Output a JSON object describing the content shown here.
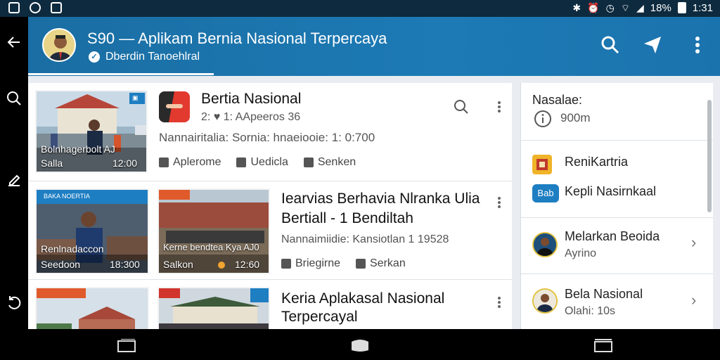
{
  "status_bar": {
    "battery": "18%",
    "time": "1:31"
  },
  "app_bar": {
    "title": "S90 — Aplikam Bernia Nasional Terpercaya",
    "subtitle": "Dberdin Tanoehlral"
  },
  "feed": {
    "cards": [
      {
        "thumb_caption": "Bolnhagerbolt AJ",
        "thumb_caption2": "Salla",
        "thumb_time": "12:00",
        "title": "Bertia Nasional",
        "byline": "2: ♥ 1: AApeeros 36",
        "meta": "Nannairitalia: Sornia: hnaeiooie: 1: 0:700",
        "actions": [
          "Aplerome",
          "Uedicla",
          "Senken"
        ]
      },
      {
        "thumb_badge": "BAKA NOERTIA",
        "thumb_caption": "Renlnadaccon",
        "thumb_caption2": "Seedoon",
        "thumb_time": "18:300",
        "thumb2_caption": "Kerne bendtea Kya AJ0",
        "thumb2_caption2": "Salkon",
        "thumb2_time": "12:60",
        "title_line1": "Iearvias Berhavia Nlranka Ulia",
        "title_line2": "Bertiall - 1 Bendiltah",
        "meta": "Nannaimiidie: Kansiotlan 1 19528",
        "actions": [
          "Briegirne",
          "Serkan"
        ]
      },
      {
        "title_line1": "Keria Aplakasal Nasional",
        "title_line2": "Terpercayal"
      }
    ]
  },
  "panel": {
    "label": "Nasalae:",
    "value": "900m",
    "item1": "ReniKartria",
    "item2_badge": "Bab",
    "item2": "Kepli Nasirnkaal",
    "item3_line1": "Melarkan Beoida",
    "item3_line2": "Ayrino",
    "item4_line1": "Bela Nasional",
    "item4_line2": "Olahi: 10s"
  },
  "colors": {
    "app_bar": "#1b73ad",
    "accent": "#1e7ec2",
    "status_bar": "#0d2a3f"
  }
}
